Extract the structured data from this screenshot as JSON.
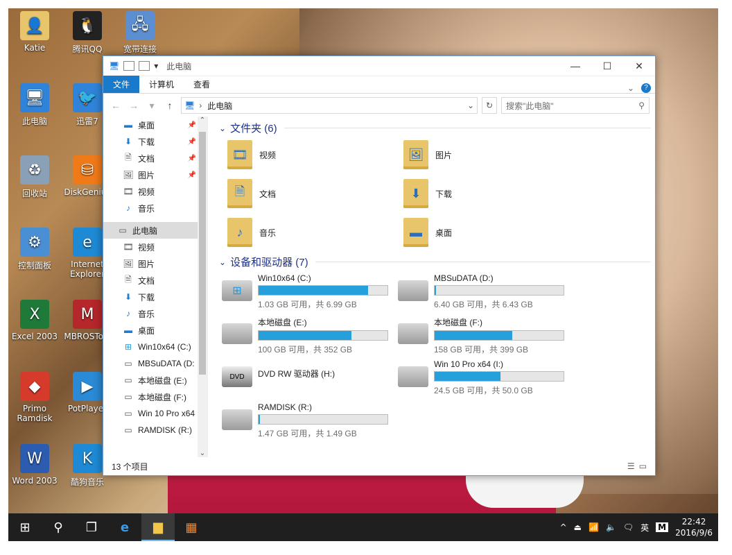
{
  "desktop": {
    "icons": [
      {
        "label": "Katie",
        "icon": "user-folder-icon",
        "color": "#e8c56b"
      },
      {
        "label": "腾讯QQ",
        "icon": "qq-penguin-icon",
        "color": "#222222"
      },
      {
        "label": "宽带连接",
        "icon": "network-connection-icon",
        "color": "#5b8fd1"
      },
      {
        "label": "此电脑",
        "icon": "computer-icon",
        "color": "#2f84d9"
      },
      {
        "label": "迅雷7",
        "icon": "thunder-bird-icon",
        "color": "#2f84d9"
      },
      {
        "label": "回收站",
        "icon": "recycle-bin-icon",
        "color": "#8aa0b6"
      },
      {
        "label": "DiskGenius",
        "icon": "diskgenius-icon",
        "color": "#f07a18"
      },
      {
        "label": "控制面板",
        "icon": "control-panel-icon",
        "color": "#4a8fd4"
      },
      {
        "label": "Internet Explorer",
        "icon": "internet-explorer-icon",
        "color": "#1e8ad6"
      },
      {
        "label": "Excel 2003",
        "icon": "excel-icon",
        "color": "#1f7a3a"
      },
      {
        "label": "MBROSTool",
        "icon": "mbros-tool-icon",
        "color": "#b5272a"
      },
      {
        "label": "Primo Ramdisk",
        "icon": "primo-ramdisk-icon",
        "color": "#d63a2a"
      },
      {
        "label": "PotPlayer",
        "icon": "potplayer-icon",
        "color": "#2a8ad6"
      },
      {
        "label": "Word 2003",
        "icon": "word-icon",
        "color": "#2c5cb0"
      },
      {
        "label": "酷狗音乐",
        "icon": "kugou-music-icon",
        "color": "#1e8ad6"
      }
    ]
  },
  "window": {
    "title": "此电脑",
    "controls": {
      "minimize": "—",
      "maximize": "☐",
      "close": "✕"
    },
    "ribbon_tabs": [
      "文件",
      "计算机",
      "查看"
    ],
    "address": {
      "path": "此电脑"
    },
    "search": {
      "placeholder": "搜索\"此电脑\""
    },
    "nav_pane": {
      "quick_access": [
        {
          "label": "桌面",
          "icon": "desktop-icon",
          "pinned": true
        },
        {
          "label": "下载",
          "icon": "download-arrow-icon",
          "pinned": true
        },
        {
          "label": "文档",
          "icon": "document-icon",
          "pinned": true
        },
        {
          "label": "图片",
          "icon": "pictures-icon",
          "pinned": true
        },
        {
          "label": "视频",
          "icon": "video-icon",
          "pinned": false
        },
        {
          "label": "音乐",
          "icon": "music-note-icon",
          "pinned": false
        }
      ],
      "this_pc": "此电脑",
      "pc_items": [
        {
          "label": "视频",
          "icon": "video-icon"
        },
        {
          "label": "图片",
          "icon": "pictures-icon"
        },
        {
          "label": "文档",
          "icon": "document-icon"
        },
        {
          "label": "下载",
          "icon": "download-arrow-icon"
        },
        {
          "label": "音乐",
          "icon": "music-note-icon"
        },
        {
          "label": "桌面",
          "icon": "desktop-icon"
        },
        {
          "label": "Win10x64 (C:)",
          "icon": "windows-drive-icon"
        },
        {
          "label": "MBSuDATA (D:",
          "icon": "drive-icon"
        },
        {
          "label": "本地磁盘 (E:)",
          "icon": "drive-icon"
        },
        {
          "label": "本地磁盘 (F:)",
          "icon": "drive-icon"
        },
        {
          "label": "Win 10 Pro x64",
          "icon": "drive-icon"
        },
        {
          "label": "RAMDISK (R:)",
          "icon": "drive-icon"
        }
      ]
    },
    "folders_header": "文件夹 (6)",
    "folders": [
      {
        "label": "视频",
        "icon": "video-folder-icon"
      },
      {
        "label": "图片",
        "icon": "pictures-folder-icon"
      },
      {
        "label": "文档",
        "icon": "documents-folder-icon"
      },
      {
        "label": "下载",
        "icon": "downloads-folder-icon"
      },
      {
        "label": "音乐",
        "icon": "music-folder-icon"
      },
      {
        "label": "桌面",
        "icon": "desktop-folder-icon"
      }
    ],
    "drives_header": "设备和驱动器 (7)",
    "drives": [
      {
        "name": "Win10x64 (C:)",
        "free": "1.03 GB 可用，共 6.99 GB",
        "used_fraction": 0.85,
        "icon": "windows-drive-icon"
      },
      {
        "name": "MBSuDATA (D:)",
        "free": "6.40 GB 可用，共 6.43 GB",
        "used_fraction": 0.005,
        "icon": "drive-icon"
      },
      {
        "name": "本地磁盘 (E:)",
        "free": "100 GB 可用，共 352 GB",
        "used_fraction": 0.72,
        "icon": "drive-icon"
      },
      {
        "name": "本地磁盘 (F:)",
        "free": "158 GB 可用，共 399 GB",
        "used_fraction": 0.6,
        "icon": "drive-icon"
      },
      {
        "name": "DVD RW 驱动器 (H:)",
        "free": "",
        "used_fraction": null,
        "icon": "dvd-drive-icon"
      },
      {
        "name": "Win 10 Pro x64 (I:)",
        "free": "24.5 GB 可用，共 50.0 GB",
        "used_fraction": 0.51,
        "icon": "drive-icon"
      },
      {
        "name": "RAMDISK (R:)",
        "free": "1.47 GB 可用，共 1.49 GB",
        "used_fraction": 0.013,
        "icon": "drive-icon"
      }
    ],
    "status": {
      "count": "13 个项目"
    }
  },
  "taskbar": {
    "language": "英",
    "ime": "M",
    "time": "22:42",
    "date": "2016/9/6"
  },
  "colors": {
    "accent": "#1979ca",
    "bar_fill": "#26a0da",
    "header_text": "#1e3287"
  }
}
